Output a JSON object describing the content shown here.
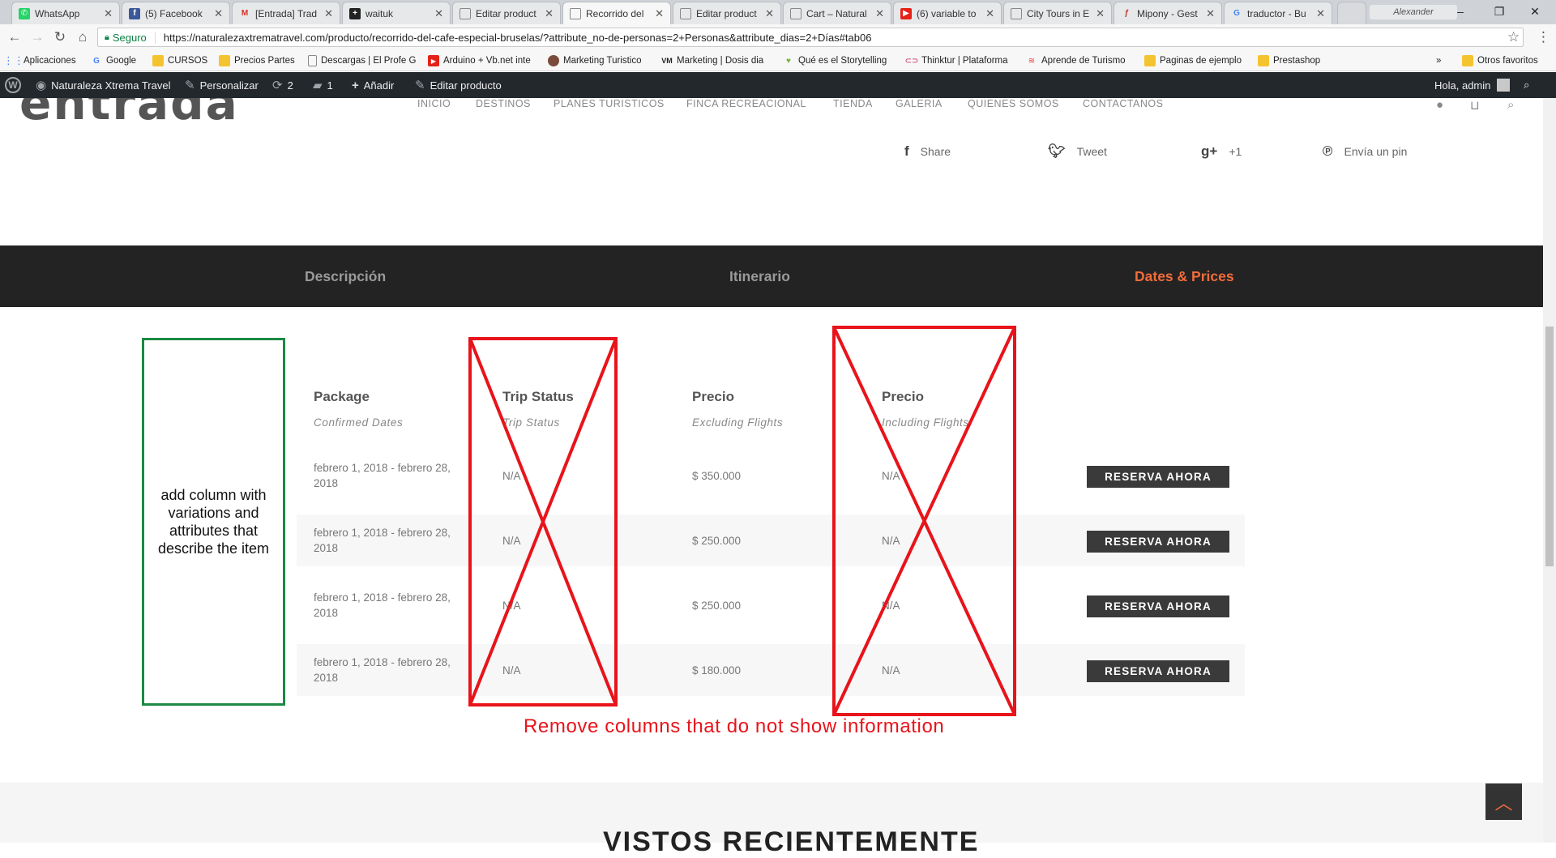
{
  "browser": {
    "tabs": [
      {
        "title": "WhatsApp",
        "icon": "whatsapp-icon",
        "color": "#25d366",
        "glyph": "✆"
      },
      {
        "title": "(5) Facebook",
        "icon": "facebook-icon",
        "color": "#3b5998",
        "glyph": "f"
      },
      {
        "title": "[Entrada] Trad",
        "icon": "gmail-icon",
        "color": "#d93025",
        "glyph": "M"
      },
      {
        "title": "waituk",
        "icon": "plus-box-icon",
        "color": "#222222",
        "glyph": "+"
      },
      {
        "title": "Editar product",
        "icon": "page-icon",
        "color": "#888888",
        "glyph": ""
      },
      {
        "title": "Recorrido del",
        "icon": "page-icon",
        "color": "#888888",
        "glyph": ""
      },
      {
        "title": "Editar product",
        "icon": "page-icon",
        "color": "#888888",
        "glyph": ""
      },
      {
        "title": "Cart – Natural",
        "icon": "page-icon",
        "color": "#888888",
        "glyph": ""
      },
      {
        "title": "(6) variable to",
        "icon": "youtube-icon",
        "color": "#e62117",
        "glyph": "▶"
      },
      {
        "title": "City Tours in E",
        "icon": "page-icon",
        "color": "#888888",
        "glyph": ""
      },
      {
        "title": "Mipony - Gest",
        "icon": "mipony-icon",
        "color": "#c0392b",
        "glyph": "ƒ"
      },
      {
        "title": "traductor - Bu",
        "icon": "google-icon",
        "color": "#4285f4",
        "glyph": "G"
      }
    ],
    "user_name": "Alexander",
    "url_secure_label": "Seguro",
    "url": "https://naturalezaxtrematravel.com/producto/recorrido-del-cafe-especial-bruselas/?attribute_no-de-personas=2+Personas&attribute_dias=2+Días#tab06",
    "bookmarks": [
      {
        "label": "Aplicaciones",
        "icon": "apps-grid-icon"
      },
      {
        "label": "Google",
        "icon": "google-icon"
      },
      {
        "label": "CURSOS",
        "icon": "folder-icon"
      },
      {
        "label": "Precios Partes",
        "icon": "folder-icon"
      },
      {
        "label": "Descargas | El Profe G",
        "icon": "page-icon"
      },
      {
        "label": "Arduino + Vb.net inte",
        "icon": "youtube-icon"
      },
      {
        "label": "Marketing Turistico",
        "icon": "person-icon"
      },
      {
        "label": "Marketing | Dosis dia",
        "icon": "vm-icon"
      },
      {
        "label": "Qué es el Storytelling",
        "icon": "heart-icon"
      },
      {
        "label": "Thinktur | Plataforma",
        "icon": "thinktur-icon"
      },
      {
        "label": "Aprende de Turismo",
        "icon": "stack-icon"
      },
      {
        "label": "Paginas de ejemplo",
        "icon": "folder-icon"
      },
      {
        "label": "Prestashop",
        "icon": "folder-icon"
      }
    ],
    "bookmarks_more": "»",
    "other_bookmarks": "Otros favoritos"
  },
  "wp_admin_bar": {
    "site_name": "Naturaleza Xtrema Travel",
    "customize": "Personalizar",
    "updates_count": "2",
    "comments_count": "1",
    "add_new": "Añadir",
    "edit_product": "Editar producto",
    "greeting": "Hola, admin"
  },
  "site": {
    "logo_text": "entrada",
    "nav": [
      "INICIO",
      "DESTINOS",
      "PLANES TURISTICOS",
      "FINCA RECREACIONAL",
      "TIENDA",
      "GALERIA",
      "QUIENES SOMOS",
      "CONTACTANOS"
    ]
  },
  "share": {
    "facebook": "Share",
    "twitter": "Tweet",
    "gplus": "+1",
    "pinterest": "Envía un pin"
  },
  "product_tabs": {
    "items": [
      "Descripción",
      "Itinerario",
      "Dates & Prices"
    ],
    "active_index": 2,
    "active_color": "#f26c3b"
  },
  "dates_table": {
    "headers": [
      {
        "title": "Package",
        "subtitle": "Confirmed Dates"
      },
      {
        "title": "Trip Status",
        "subtitle": "Trip Status"
      },
      {
        "title": "Precio",
        "subtitle": "Excluding Flights"
      },
      {
        "title": "Precio",
        "subtitle": "Including Flights"
      }
    ],
    "rows": [
      {
        "dates": "febrero 1, 2018 - febrero 28, 2018",
        "status": "N/A",
        "price_excl": "$ 350.000",
        "price_incl": "N/A",
        "button": "RESERVA AHORA"
      },
      {
        "dates": "febrero 1, 2018 - febrero 28, 2018",
        "status": "N/A",
        "price_excl": "$ 250.000",
        "price_incl": "N/A",
        "button": "RESERVA AHORA"
      },
      {
        "dates": "febrero 1, 2018 - febrero 28, 2018",
        "status": "N/A",
        "price_excl": "$ 250.000",
        "price_incl": "N/A",
        "button": "RESERVA AHORA"
      },
      {
        "dates": "febrero 1, 2018 - febrero 28, 2018",
        "status": "N/A",
        "price_excl": "$ 180.000",
        "price_incl": "N/A",
        "button": "RESERVA AHORA"
      }
    ]
  },
  "annotations": {
    "green_note": "add column with variations and attributes that describe the item",
    "green_color": "#1c8a44",
    "red_note": "Remove columns that do not show information",
    "red_color": "#e8141b"
  },
  "recently_viewed_title": "VISTOS RECIENTEMENTE"
}
